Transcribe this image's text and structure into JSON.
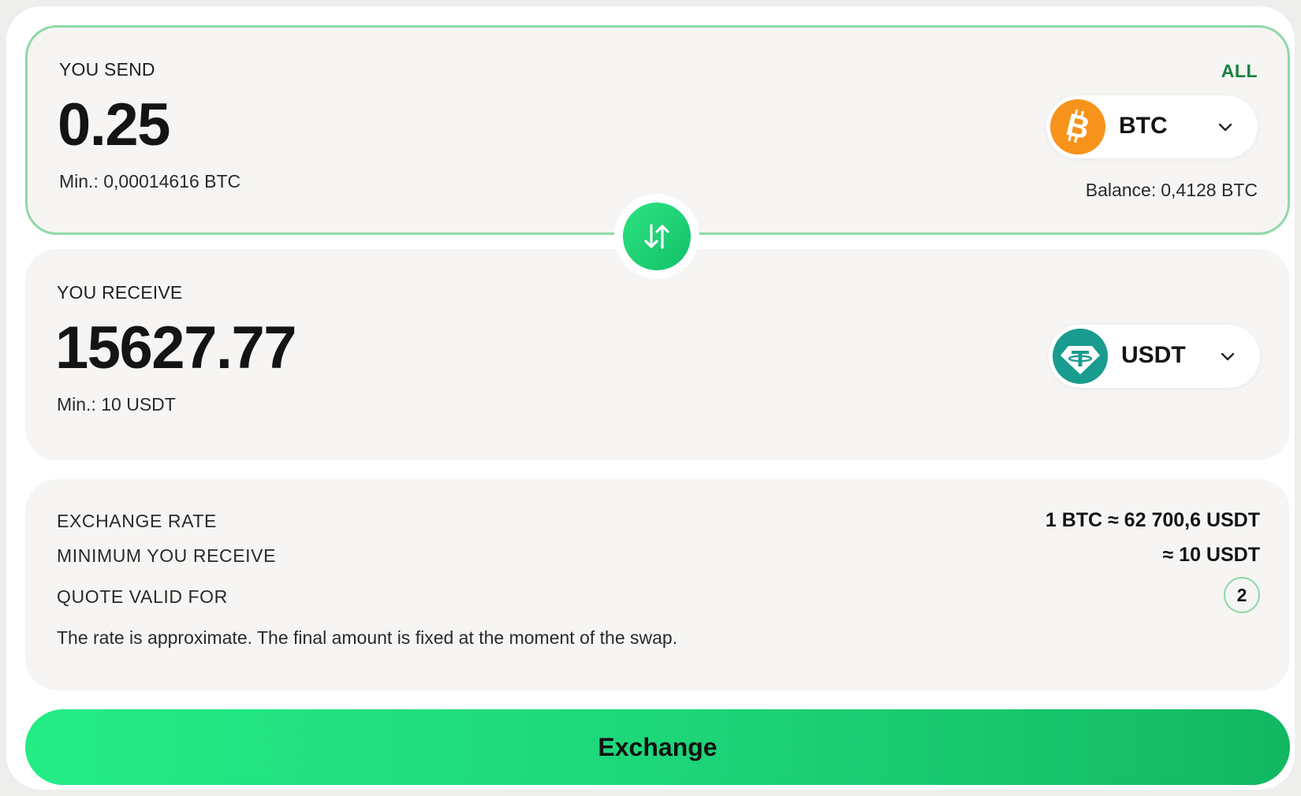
{
  "send": {
    "label": "YOU SEND",
    "all_label": "ALL",
    "amount": "0.25",
    "min": "Min.: 0,00014616 BTC",
    "balance_label": "Balance:",
    "balance_value": "0,4128 BTC",
    "currency": "BTC",
    "currency_icon": "bitcoin-icon",
    "currency_color": "#f7931a"
  },
  "receive": {
    "label": "YOU RECEIVE",
    "amount": "15627.77",
    "min": "Min.: 10 USDT",
    "currency": "USDT",
    "currency_icon": "tether-icon",
    "currency_color": "#1a9b8f"
  },
  "swap": {
    "icon": "swap-arrows-icon",
    "color": "#1ed67a"
  },
  "info": {
    "rate_label": "EXCHANGE RATE",
    "rate_value": "1 BTC ≈ 62 700,6 USDT",
    "min_label": "MINIMUM YOU RECEIVE",
    "min_value": "≈ 10 USDT",
    "quote_label": "QUOTE VALID FOR",
    "quote_value": "2",
    "note": "The rate is approximate. The final amount is fixed at the moment of the swap."
  },
  "action": {
    "exchange_label": "Exchange"
  },
  "colors": {
    "accent": "#1ed67a",
    "accent_border": "#8ed8a8",
    "all_link": "#17803f",
    "panel_bg": "#f6f5f3"
  }
}
